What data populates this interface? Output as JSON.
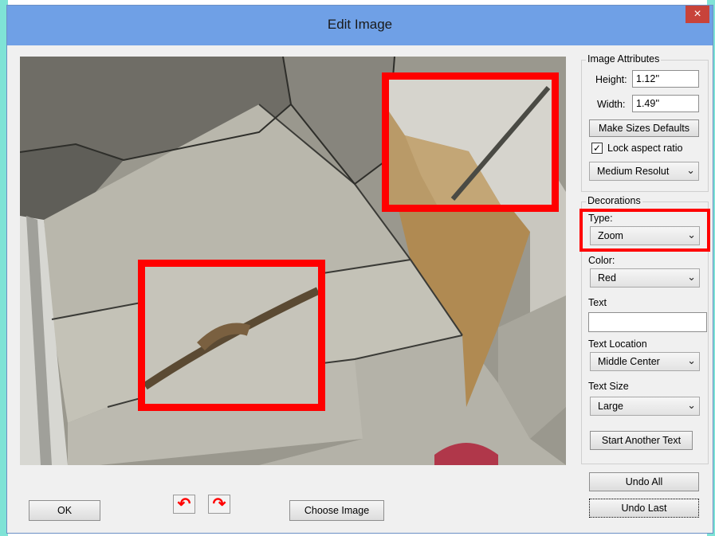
{
  "window": {
    "title": "Edit Image",
    "close_glyph": "×"
  },
  "image_attributes": {
    "group_label": "Image Attributes",
    "height_label": "Height:",
    "height_value": "1.12''",
    "width_label": "Width:",
    "width_value": "1.49''",
    "make_defaults_label": "Make Sizes Defaults",
    "lock_aspect_label": "Lock aspect ratio",
    "lock_aspect_checked": true,
    "resolution_value": "Medium Resolut"
  },
  "decorations": {
    "group_label": "Decorations",
    "type_label": "Type:",
    "type_value": "Zoom",
    "color_label": "Color:",
    "color_value": "Red",
    "text_label": "Text",
    "text_value": "",
    "text_location_label": "Text Location",
    "text_location_value": "Middle Center",
    "text_size_label": "Text Size",
    "text_size_value": "Large",
    "start_another_text_label": "Start Another Text"
  },
  "buttons": {
    "undo_all": "Undo All",
    "undo_last": "Undo Last",
    "ok": "OK",
    "choose_image": "Choose Image",
    "rotate_left_glyph": "↶",
    "rotate_right_glyph": "↷"
  },
  "colors": {
    "titlebar": "#6fa0e6",
    "accent_red": "#ff0000",
    "close_button": "#c8433a"
  },
  "icons": {
    "close": "close-icon",
    "rotate_left": "rotate-left-icon",
    "rotate_right": "rotate-right-icon",
    "chevron": "chevron-down-icon",
    "check": "checkmark-icon"
  }
}
